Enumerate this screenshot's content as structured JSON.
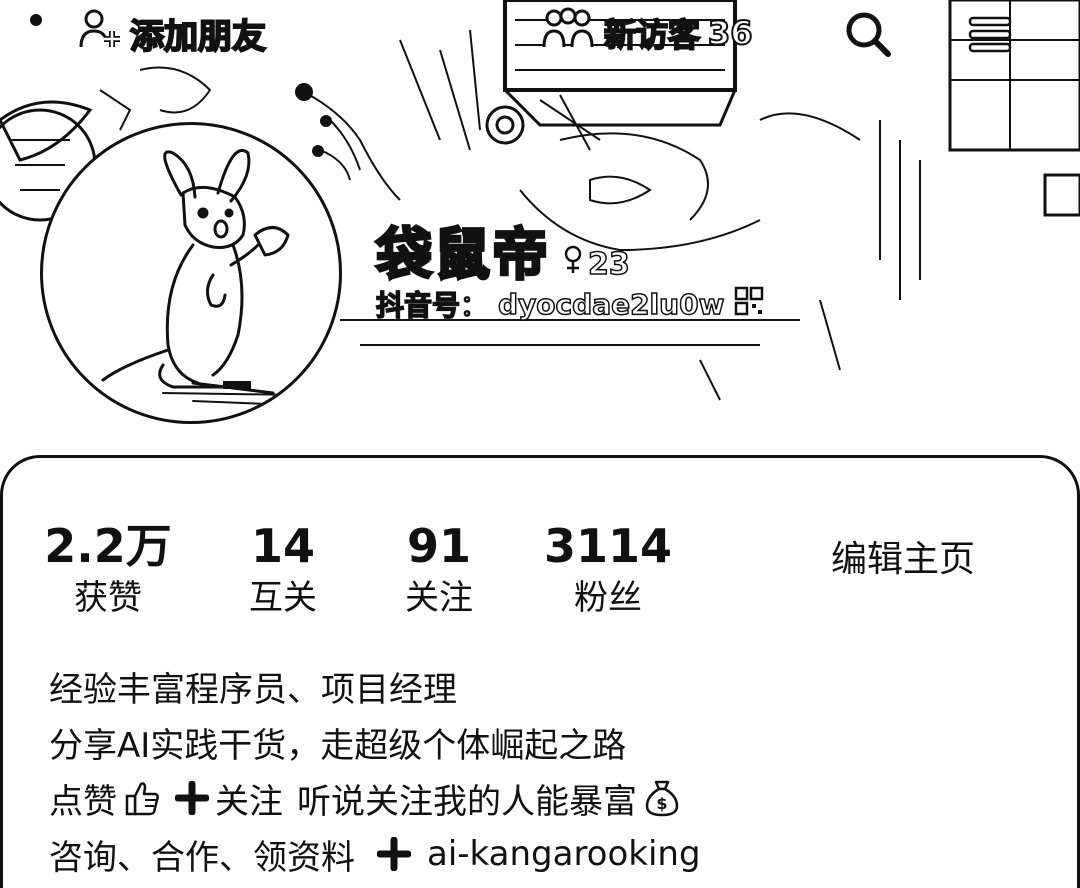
{
  "header": {
    "add_friend_label": "添加朋友",
    "visitor_label": "新访客",
    "visitor_count": "36"
  },
  "profile": {
    "display_name": "袋鼠帝",
    "age": "23",
    "douyin_id_label": "抖音号：",
    "douyin_id": "dyocdae2lu0w"
  },
  "stats": [
    {
      "value": "2.2万",
      "label": "获赞"
    },
    {
      "value": "14",
      "label": "互关"
    },
    {
      "value": "91",
      "label": "关注"
    },
    {
      "value": "3114",
      "label": "粉丝"
    }
  ],
  "edit_profile_label": "编辑主页",
  "bio": {
    "line1": "经验丰富程序员、项目经理",
    "line2": "分享AI实践干货，走超级个体崛起之路",
    "line3_a": "点赞",
    "line3_b": "关注",
    "line3_c": "听说关注我的人能暴富",
    "line4_a": "咨询、合作、领资料",
    "line4_b": "ai-kangarooking"
  },
  "icons": {
    "add_friend": "person-plus-icon",
    "visitor": "people-icon",
    "search": "search-icon",
    "menu": "hamburger-menu-icon",
    "age": "gender-icon",
    "qr": "qr-code-icon",
    "thumbs_up": "thumbs-up-icon",
    "plus": "plus-icon",
    "money_bag": "money-bag-icon"
  }
}
